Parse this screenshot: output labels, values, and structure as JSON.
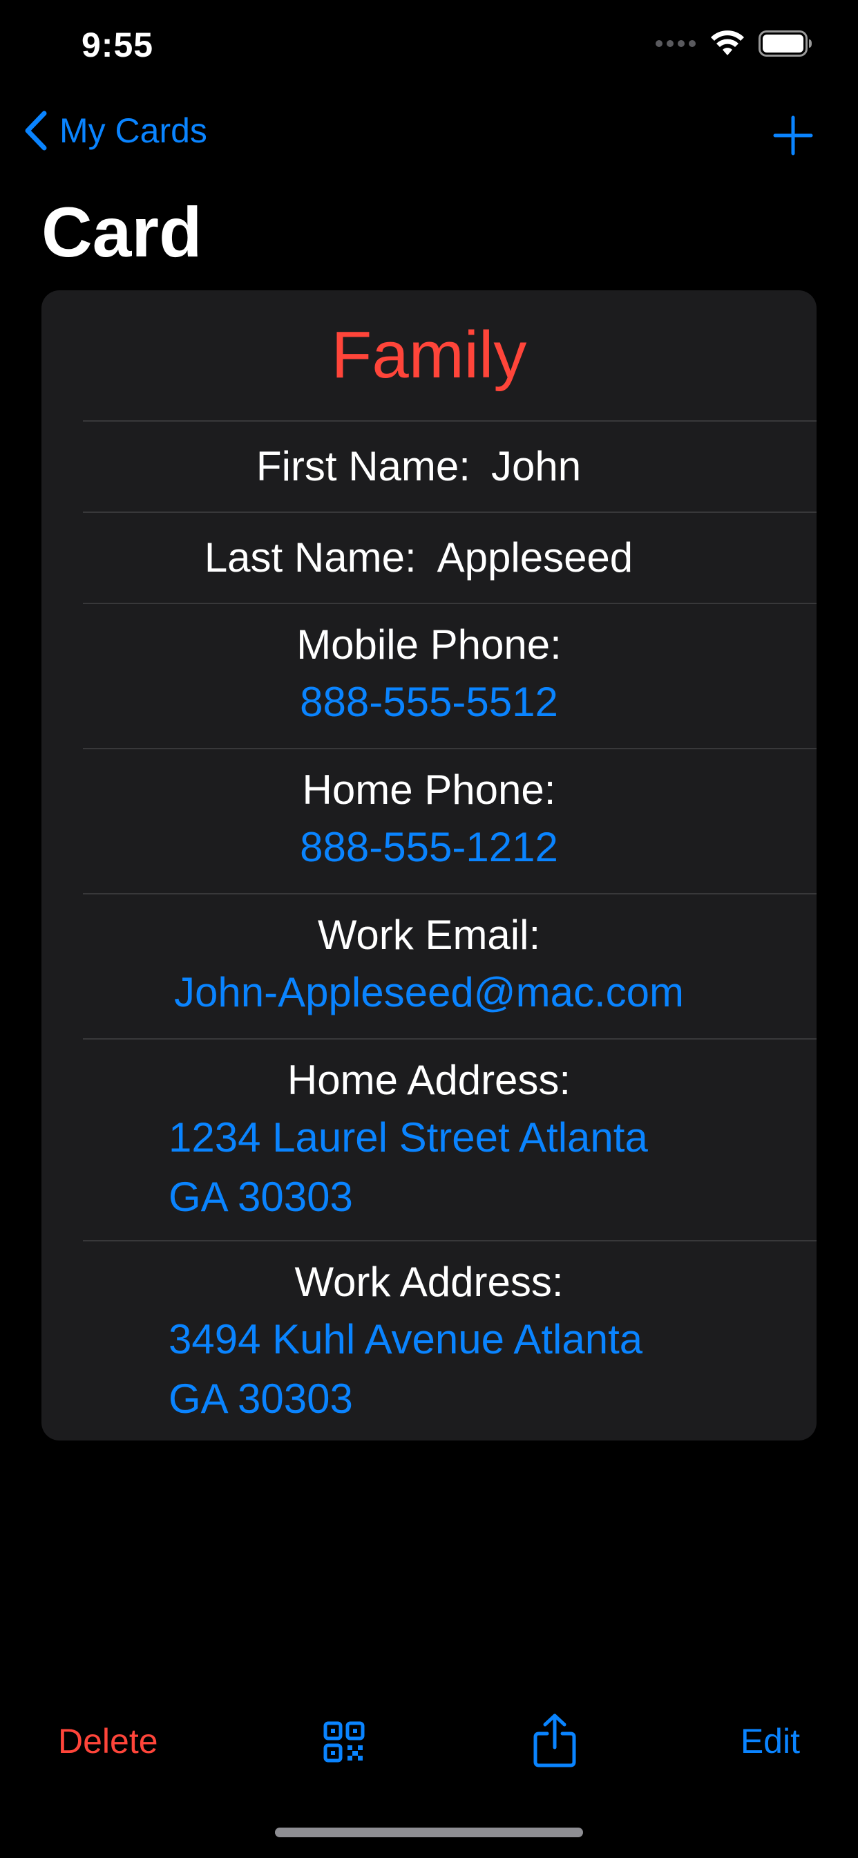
{
  "status_bar": {
    "time": "9:55"
  },
  "nav": {
    "back_label": "My Cards",
    "title": "Card"
  },
  "card": {
    "category": "Family",
    "fields": {
      "first_name": {
        "label": "First Name:",
        "value": "John"
      },
      "last_name": {
        "label": "Last Name:",
        "value": "Appleseed"
      },
      "mobile_phone": {
        "label": "Mobile Phone:",
        "value": "888-555-5512"
      },
      "home_phone": {
        "label": "Home Phone:",
        "value": "888-555-1212"
      },
      "work_email": {
        "label": "Work Email:",
        "value": "John-Appleseed@mac.com"
      },
      "home_address": {
        "label": "Home Address:",
        "line1": "1234 Laurel Street Atlanta",
        "line2": "GA 30303"
      },
      "work_address": {
        "label": "Work Address:",
        "line1": "3494 Kuhl Avenue Atlanta",
        "line2": "GA 30303"
      }
    }
  },
  "toolbar": {
    "delete_label": "Delete",
    "qr_icon": "qr-code-icon",
    "share_icon": "share-icon",
    "edit_label": "Edit"
  },
  "colors": {
    "background": "#000000",
    "card_background": "#1c1c1e",
    "accent_blue": "#0a84ff",
    "destructive_red": "#ff453a",
    "divider": "#38383a"
  }
}
